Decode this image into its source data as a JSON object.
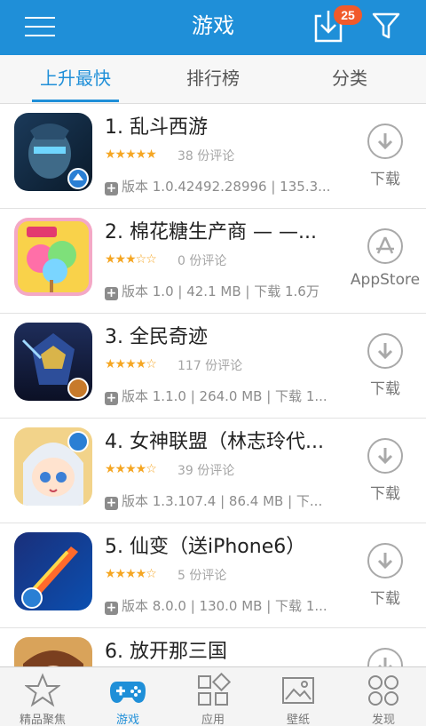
{
  "header": {
    "title": "游戏",
    "download_badge": "25"
  },
  "tabs": [
    {
      "label": "上升最快",
      "active": true
    },
    {
      "label": "排行榜",
      "active": false
    },
    {
      "label": "分类",
      "active": false
    }
  ],
  "apps": [
    {
      "name": "1. 乱斗西游",
      "stars": 5,
      "reviews": "38 份评论",
      "meta": "版本 1.0.42492.28996 | 135.3...",
      "action": "下载",
      "action_icon": "download-icon"
    },
    {
      "name": "2. 棉花糖生产商 — —...",
      "stars": 3,
      "reviews": "0 份评论",
      "meta": "版本 1.0 | 42.1 MB | 下载 1.6万",
      "action": "AppStore",
      "action_icon": "appstore-icon"
    },
    {
      "name": "3. 全民奇迹",
      "stars": 4,
      "reviews": "117 份评论",
      "meta": "版本 1.1.0 | 264.0 MB | 下载 1...",
      "action": "下载",
      "action_icon": "download-icon"
    },
    {
      "name": "4. 女神联盟（林志玲代...",
      "stars": 4,
      "reviews": "39 份评论",
      "meta": "版本 1.3.107.4 | 86.4 MB | 下...",
      "action": "下载",
      "action_icon": "download-icon"
    },
    {
      "name": "5. 仙变（送iPhone6）",
      "stars": 4,
      "reviews": "5 份评论",
      "meta": "版本 8.0.0 | 130.0 MB | 下载 1...",
      "action": "下载",
      "action_icon": "download-icon"
    },
    {
      "name": "6. 放开那三国",
      "stars": 0,
      "reviews": "",
      "meta": "",
      "action": "",
      "action_icon": "download-icon"
    }
  ],
  "bottom_nav": [
    {
      "label": "精品聚焦",
      "icon": "star-icon",
      "active": false
    },
    {
      "label": "游戏",
      "icon": "gamepad-icon",
      "active": true
    },
    {
      "label": "应用",
      "icon": "apps-icon",
      "active": false
    },
    {
      "label": "壁纸",
      "icon": "wallpaper-icon",
      "active": false
    },
    {
      "label": "发现",
      "icon": "discover-icon",
      "active": false
    }
  ],
  "colors": {
    "primary": "#1f8fd8",
    "badge": "#f15a2b",
    "star": "#f5a623"
  }
}
